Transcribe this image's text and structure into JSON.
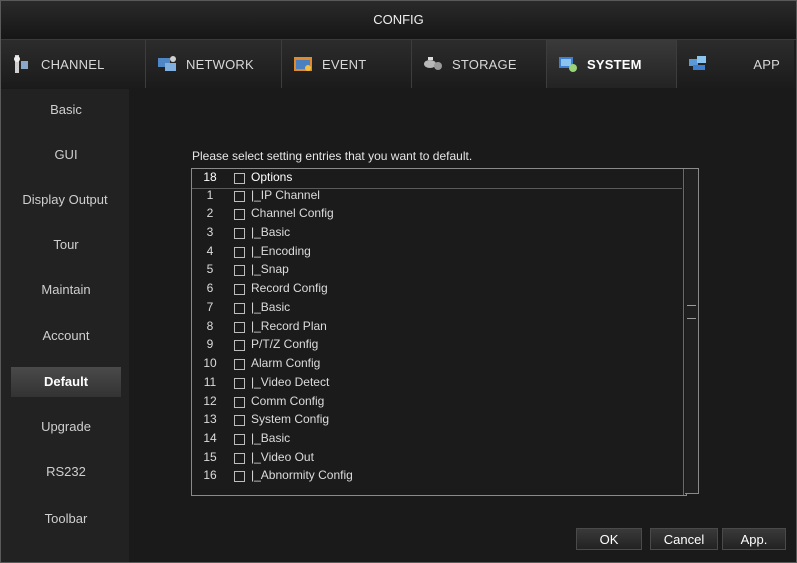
{
  "window": {
    "title": "CONFIG"
  },
  "tabs": [
    {
      "label": "CHANNEL",
      "icon": "channel-icon"
    },
    {
      "label": "NETWORK",
      "icon": "network-icon"
    },
    {
      "label": "EVENT",
      "icon": "event-icon"
    },
    {
      "label": "STORAGE",
      "icon": "storage-icon"
    },
    {
      "label": "SYSTEM",
      "icon": "system-icon",
      "active": true
    },
    {
      "label": "APP",
      "icon": "app-icon"
    }
  ],
  "sidebar": {
    "items": [
      {
        "label": "Basic"
      },
      {
        "label": "GUI"
      },
      {
        "label": "Display Output"
      },
      {
        "label": "Tour"
      },
      {
        "label": "Maintain"
      },
      {
        "label": "Account"
      },
      {
        "label": "Default",
        "active": true
      },
      {
        "label": "Upgrade"
      },
      {
        "label": "RS232"
      },
      {
        "label": "Toolbar"
      }
    ]
  },
  "main": {
    "prompt": "Please select setting entries that you want to default.",
    "list_header": {
      "count": "18",
      "label": "Options"
    },
    "rows": [
      {
        "num": "1",
        "label": "|_IP Channel"
      },
      {
        "num": "2",
        "label": "Channel Config"
      },
      {
        "num": "3",
        "label": "|_Basic"
      },
      {
        "num": "4",
        "label": "|_Encoding"
      },
      {
        "num": "5",
        "label": "|_Snap"
      },
      {
        "num": "6",
        "label": "Record Config"
      },
      {
        "num": "7",
        "label": "|_Basic"
      },
      {
        "num": "8",
        "label": "|_Record Plan"
      },
      {
        "num": "9",
        "label": "P/T/Z Config"
      },
      {
        "num": "10",
        "label": "Alarm Config"
      },
      {
        "num": "11",
        "label": "|_Video Detect"
      },
      {
        "num": "12",
        "label": "Comm Config"
      },
      {
        "num": "13",
        "label": "System Config"
      },
      {
        "num": "14",
        "label": "|_Basic"
      },
      {
        "num": "15",
        "label": "|_Video Out"
      },
      {
        "num": "16",
        "label": "|_Abnormity Config"
      }
    ]
  },
  "buttons": {
    "ok": "OK",
    "cancel": "Cancel",
    "apply": "App."
  },
  "colors": {
    "background": "#1a1a1a",
    "panel": "#222222",
    "text": "#dcdcdc",
    "active_tab": "#3a3a3a"
  }
}
